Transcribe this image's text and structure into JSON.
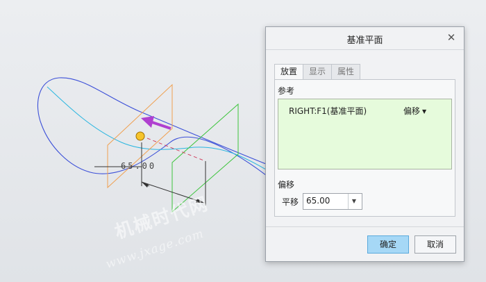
{
  "viewport": {
    "dimension_value": "65.00",
    "watermark_cn": "机械时代网",
    "watermark_url": "www.jxage.com",
    "colors": {
      "curve": "#3b4fd8",
      "curve_inner": "#2ab6e0",
      "plane_orange": "#f0a050",
      "plane_green": "#3cc43c",
      "drag_arrow": "#b040d0",
      "handle": "#f0c020"
    }
  },
  "dialog": {
    "title": "基准平面",
    "close_icon": "close-icon",
    "tabs": [
      "放置",
      "显示",
      "属性"
    ],
    "active_tab": "放置",
    "references_label": "参考",
    "reference": {
      "name": "RIGHT:F1(基准平面)",
      "constraint": "偏移"
    },
    "offset_section_label": "偏移",
    "translation_label": "平移",
    "translation_value": "65.00",
    "ok_label": "确定",
    "cancel_label": "取消",
    "colors": {
      "ref_box_bg": "#e6fbdc",
      "ok_bg": "#a6d8f6"
    }
  }
}
